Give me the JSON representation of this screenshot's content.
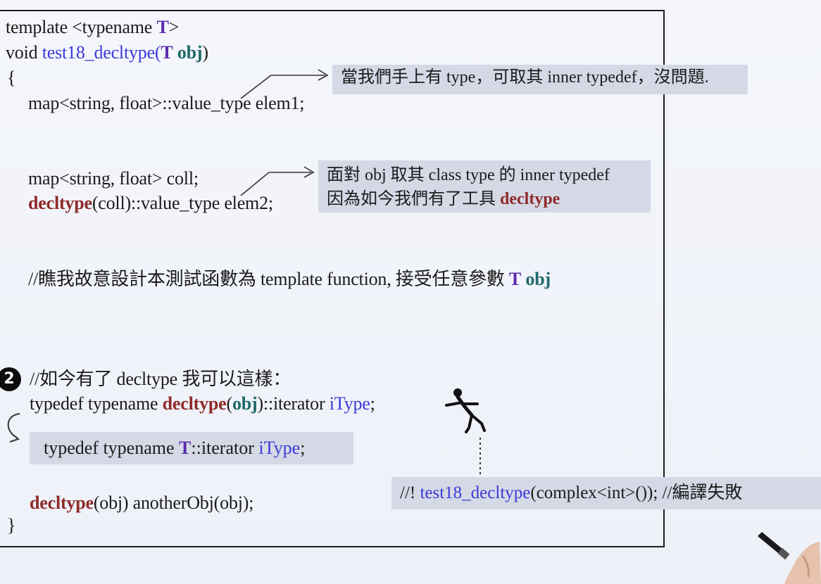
{
  "code": {
    "line1_prefix": "template <typename ",
    "line1_T": "T",
    "line1_suffix": ">",
    "line2_prefix": "void ",
    "line2_fn": "test18_decltype(",
    "line2_T": "T",
    "line2_obj": "obj",
    "line2_close": ")",
    "open_brace": "{",
    "line3": "map<string, float>::value_type elem1;",
    "line4": "map<string, float> coll;",
    "line5_decltype": "decltype",
    "line5_rest": "(coll)::value_type elem2;",
    "comment1_prefix": "//瞧我故意設計本測試函數為 template function, 接受任意參數 ",
    "comment1_T": "T",
    "comment1_obj": "obj",
    "comment2": "//如今有了 decltype 我可以這樣：",
    "line6_prefix": "typedef typename ",
    "line6_decltype": "decltype",
    "line6_open": "(",
    "line6_obj": "obj",
    "line6_mid": ")::iterator ",
    "line6_itype": "iType",
    "line6_end": ";",
    "line7_prefix": "typedef typename ",
    "line7_T": "T",
    "line7_mid": "::iterator ",
    "line7_itype": "iType",
    "line7_end": ";",
    "line8_decltype": "decltype",
    "line8_rest": "(obj) anotherObj(obj);",
    "close_brace": "}"
  },
  "notes": {
    "note1": "當我們手上有 type，可取其 inner typedef，沒問題.",
    "note2_line1": "面對 obj 取其 class type 的 inner typedef",
    "note2_line2_prefix": "因為如今我們有了工具 ",
    "note2_line2_decltype": "decltype",
    "note3_prefix": "//! ",
    "note3_fn": "test18_decltype",
    "note3_rest": "(complex<int>()); //編譯失敗"
  },
  "badge": {
    "step": "2"
  },
  "colors": {
    "keyword_blue": "#3a3ad8",
    "decltype_red": "#8f2a2a",
    "obj_teal": "#1f6a6a",
    "note_bg": "#d5d9e6"
  }
}
